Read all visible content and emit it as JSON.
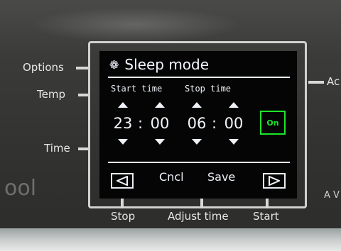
{
  "panel_labels": {
    "options": "Options",
    "temp": "Temp",
    "time": "Time",
    "right_top": "Ac",
    "brand_fragment": "ool",
    "right_bottom": "A V"
  },
  "bottom_labels": {
    "stop": "Stop",
    "adjust_time": "Adjust time",
    "start": "Start"
  },
  "screen": {
    "title": "Sleep mode",
    "title_icon": "gear-icon",
    "start_time_label": "Start time",
    "stop_time_label": "Stop time",
    "start_hours": "23",
    "start_minutes": "00",
    "stop_hours": "06",
    "stop_minutes": "00",
    "separator": ":",
    "toggle_label": "On",
    "cancel_label": "Cncl",
    "save_label": "Save"
  },
  "colors": {
    "screen_text": "#eef2f8",
    "toggle_green": "#1ee52a",
    "screen_bg": "#050505"
  }
}
